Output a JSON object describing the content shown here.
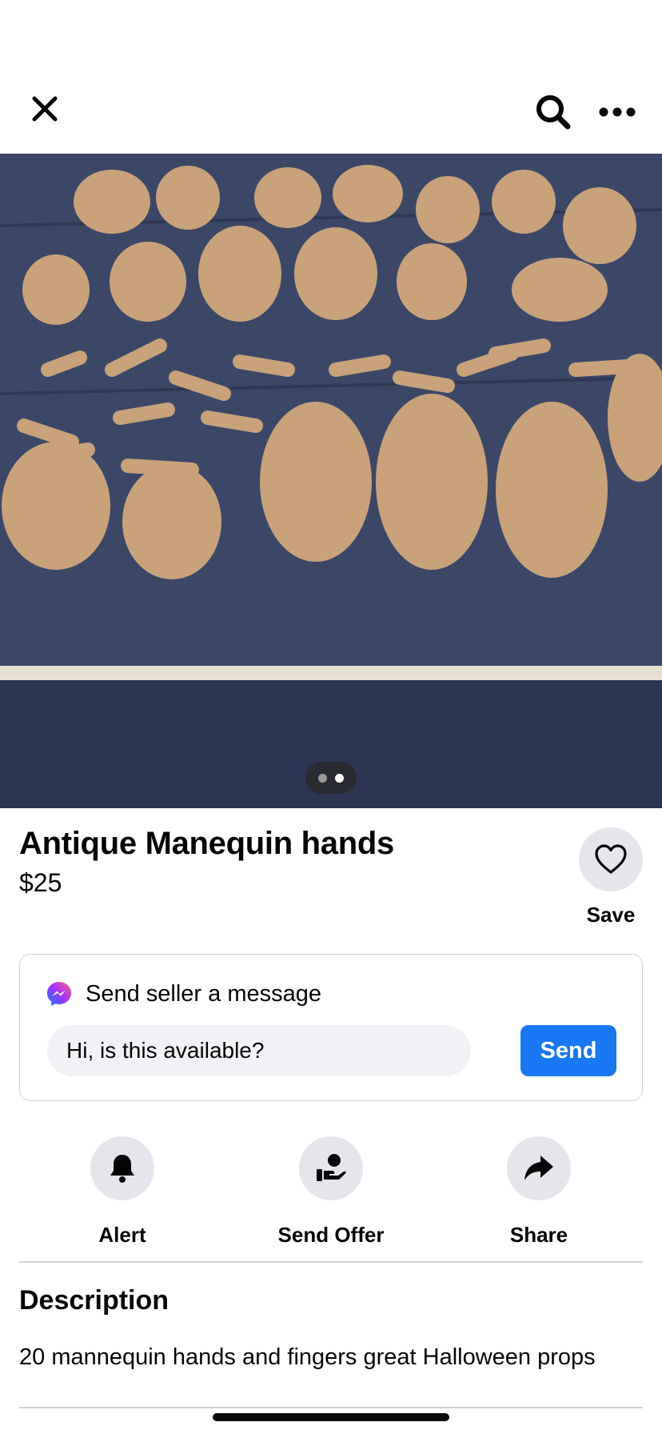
{
  "header": {
    "close_icon": "close-icon",
    "search_icon": "search-icon",
    "more_icon": "more-options-icon"
  },
  "photo": {
    "description_icon": "listing-photo",
    "page_count": 2,
    "current_page": 2
  },
  "listing": {
    "title": "Antique Manequin hands",
    "price": "$25",
    "save_label": "Save"
  },
  "message": {
    "heading": "Send seller a message",
    "input_value": "Hi, is this available?",
    "send_label": "Send"
  },
  "actions": [
    {
      "label": "Alert",
      "icon": "bell-icon"
    },
    {
      "label": "Send Offer",
      "icon": "offer-icon"
    },
    {
      "label": "Share",
      "icon": "share-icon"
    }
  ],
  "description": {
    "heading": "Description",
    "text": "20 mannequin hands and fingers great Halloween props"
  },
  "colors": {
    "accent": "#1877f2",
    "button_bg": "#e4e6eb",
    "input_bg": "#f0f2f5"
  }
}
